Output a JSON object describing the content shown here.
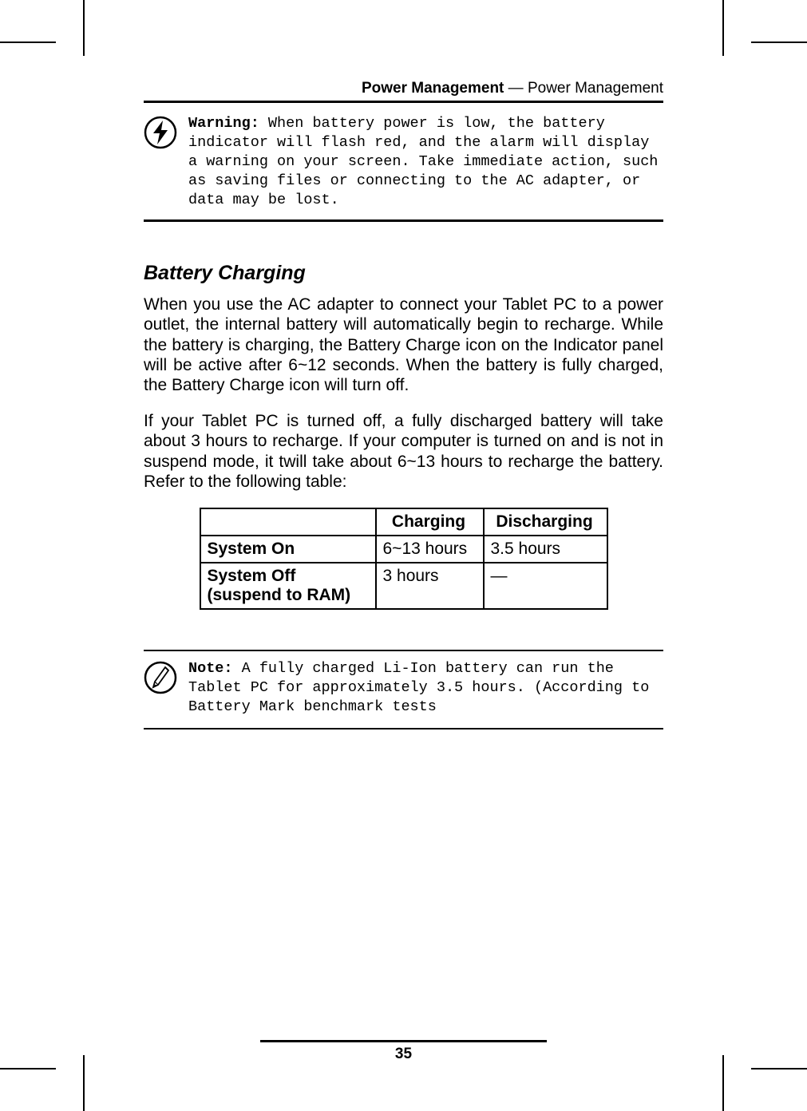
{
  "header": {
    "bold": "Power Management",
    "sep": " — ",
    "rest": "Power Management"
  },
  "warning": {
    "label": "Warning:",
    "body": " When battery power is low, the battery indicator will flash red, and the alarm will display a warning on your screen. Take immediate action, such as saving files or connecting to the AC adapter, or data may be lost."
  },
  "section_title": "Battery Charging",
  "para1": "When you use the AC adapter to connect your Tablet PC to a power outlet, the internal battery will automatically begin to recharge. While the battery is charging, the Battery Charge icon on the Indicator panel will be active after 6~12 seconds. When the battery is fully charged, the Battery Charge icon will turn off.",
  "para2": "If your Tablet PC is turned off, a fully discharged battery will take about 3 hours to recharge. If your computer is turned on and is not in suspend mode, it twill take about 6~13 hours to recharge the battery. Refer to the following table:",
  "chart_data": {
    "type": "table",
    "columns": [
      "",
      "Charging",
      "Discharging"
    ],
    "rows": [
      {
        "label": "System On",
        "charging": "6~13 hours",
        "discharging": "3.5 hours"
      },
      {
        "label_line1": "System Off",
        "label_line2": "(suspend to RAM)",
        "charging": "3 hours",
        "discharging": "—"
      }
    ]
  },
  "note": {
    "label": "Note:",
    "body": " A fully charged Li-Ion battery can run the Tablet PC for approximately 3.5 hours. (According to Battery Mark benchmark tests "
  },
  "page_number": "35"
}
